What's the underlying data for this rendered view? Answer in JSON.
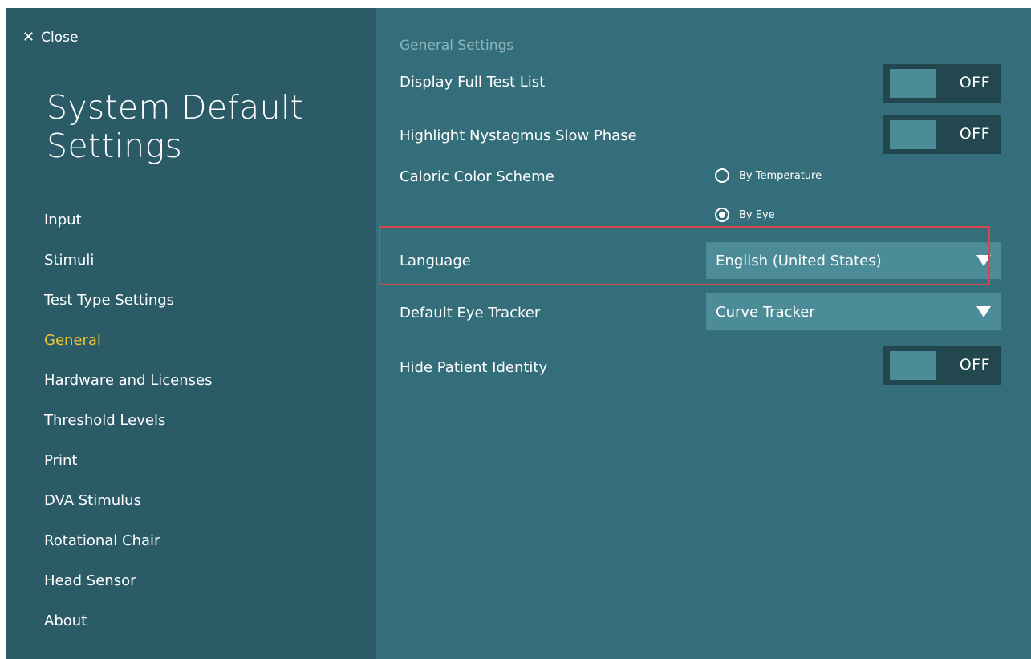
{
  "close": {
    "icon": "close-icon",
    "label": "Close"
  },
  "page_title": "System Default Settings",
  "nav": {
    "items": [
      {
        "label": "Input"
      },
      {
        "label": "Stimuli"
      },
      {
        "label": "Test Type Settings"
      },
      {
        "label": "General",
        "active": true
      },
      {
        "label": "Hardware and Licenses"
      },
      {
        "label": "Threshold Levels"
      },
      {
        "label": "Print"
      },
      {
        "label": "DVA Stimulus"
      },
      {
        "label": "Rotational Chair"
      },
      {
        "label": "Head Sensor"
      },
      {
        "label": "About"
      }
    ]
  },
  "general": {
    "section_title": "General Settings",
    "display_full_test_list": {
      "label": "Display Full Test List",
      "state": "OFF"
    },
    "highlight_nystagmus": {
      "label": "Highlight Nystagmus Slow Phase",
      "state": "OFF"
    },
    "caloric_color_scheme": {
      "label": "Caloric Color Scheme",
      "options": [
        {
          "label": "By Temperature",
          "selected": false
        },
        {
          "label": "By Eye",
          "selected": true
        }
      ]
    },
    "language": {
      "label": "Language",
      "value": "English (United States)"
    },
    "default_eye_tracker": {
      "label": "Default Eye Tracker",
      "value": "Curve Tracker"
    },
    "hide_patient_identity": {
      "label": "Hide Patient Identity",
      "state": "OFF"
    }
  },
  "colors": {
    "sidebar_bg": "#2a5b67",
    "main_bg": "#346e7a",
    "active_nav": "#f0c330",
    "toggle_track": "#22474f",
    "control_fill": "#4c8c99",
    "highlight_border": "#d9464a"
  }
}
